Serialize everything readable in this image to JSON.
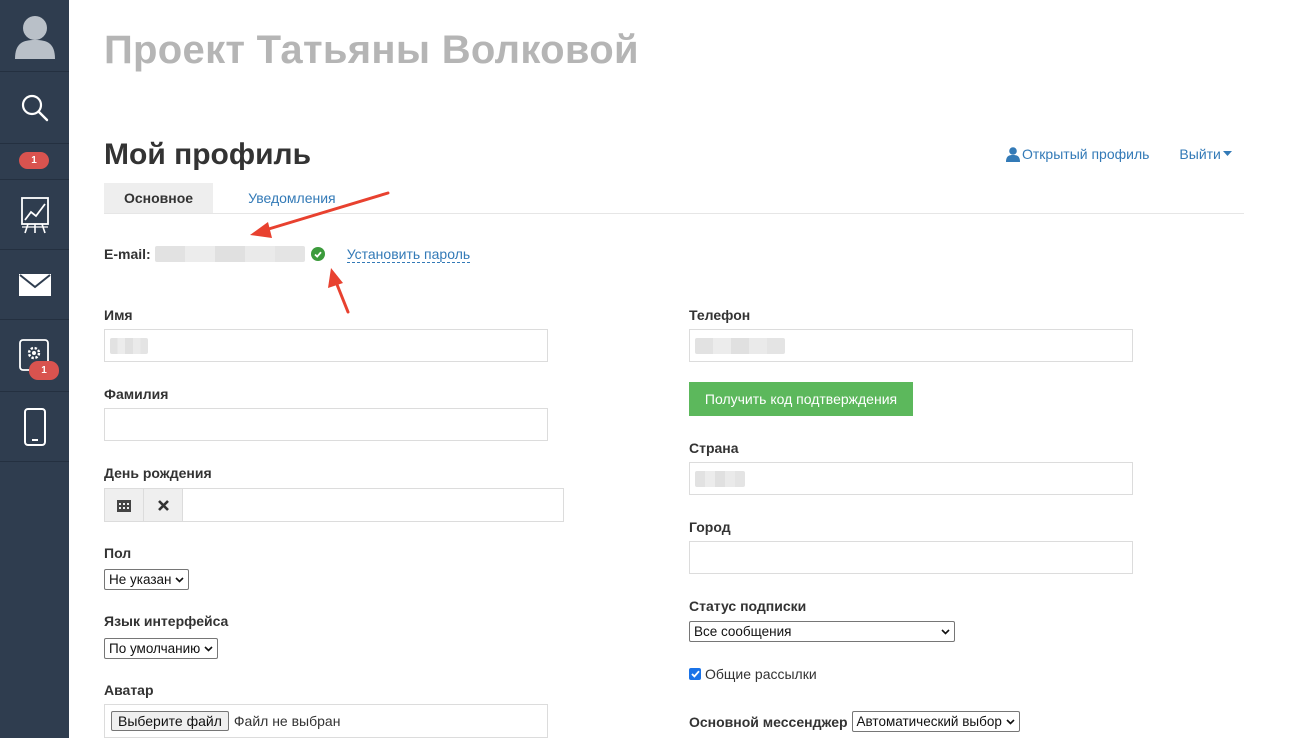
{
  "sidebar": {
    "items": [
      {
        "icon": "user-icon"
      },
      {
        "icon": "search-icon"
      },
      {
        "icon": "notifications-icon",
        "badge": "1"
      },
      {
        "icon": "chart-icon"
      },
      {
        "icon": "mail-icon"
      },
      {
        "icon": "settings-icon",
        "badge": "1"
      },
      {
        "icon": "mobile-icon"
      }
    ]
  },
  "header": {
    "project_title": "Проект Татьяны Волковой",
    "page_title": "Мой профиль",
    "open_profile": "Открытый профиль",
    "logout": "Выйти"
  },
  "tabs": [
    {
      "label": "Основное",
      "active": true
    },
    {
      "label": "Уведомления",
      "active": false
    }
  ],
  "email": {
    "label": "E-mail:",
    "set_password": "Установить пароль"
  },
  "form": {
    "name_label": "Имя",
    "surname_label": "Фамилия",
    "birthday_label": "День рождения",
    "gender_label": "Пол",
    "gender_value": "Не указан",
    "language_label": "Язык интерфейса",
    "language_value": "По умолчанию",
    "avatar_label": "Аватар",
    "file_button": "Выберите файл",
    "file_status": "Файл не выбран",
    "phone_label": "Телефон",
    "get_code_button": "Получить код подтверждения",
    "country_label": "Страна",
    "city_label": "Город",
    "subscription_label": "Статус подписки",
    "subscription_value": "Все сообщения",
    "newsletter_label": "Общие рассылки",
    "messenger_label": "Основной мессенджер",
    "messenger_value": "Автоматический выбор"
  },
  "colors": {
    "sidebar_bg": "#2f3d4f",
    "link": "#337ab7",
    "success_button": "#5cb85c",
    "badge": "#d9534f",
    "annotation_arrow": "#e8412f"
  }
}
